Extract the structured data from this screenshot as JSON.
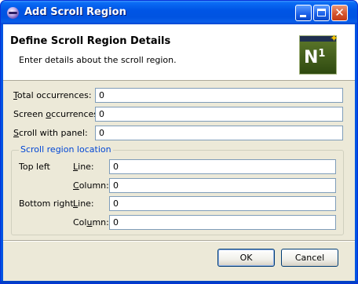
{
  "window": {
    "title": "Add Scroll Region"
  },
  "banner": {
    "title": "Define Scroll Region Details",
    "description": "Enter details about the scroll region.",
    "logo_text": "N",
    "logo_sup": "1"
  },
  "fields": {
    "total_occurrences": {
      "label_ul": "T",
      "label_rest": "otal occurrences:",
      "value": "0"
    },
    "screen_occurrences": {
      "label_pre": "Screen ",
      "label_ul": "o",
      "label_rest": "ccurrences:",
      "value": "0"
    },
    "scroll_with_panel": {
      "label_ul": "S",
      "label_rest": "croll with panel:",
      "value": "0"
    }
  },
  "location": {
    "group_title": "Scroll region location",
    "top_left": {
      "label": "Top left",
      "line_ul": "L",
      "line_rest": "ine:",
      "line_value": "0",
      "column_ul": "C",
      "column_rest": "olumn:",
      "column_value": "0"
    },
    "bottom_right": {
      "label": "Bottom right",
      "line_ul": "L",
      "line_rest": "ine:",
      "line_value": "0",
      "column_pre": "Col",
      "column_ul": "u",
      "column_rest": "mn:",
      "column_value": "0"
    }
  },
  "buttons": {
    "ok": "OK",
    "cancel": "Cancel"
  },
  "colors": {
    "titlebar": "#0055e5",
    "dialog_bg": "#ece9d8",
    "group_title": "#0046d5",
    "field_border": "#7f9db9"
  }
}
